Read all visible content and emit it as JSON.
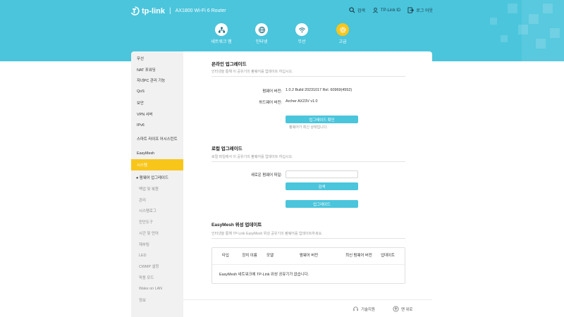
{
  "brand": {
    "name": "tp-link",
    "separator": "|",
    "model": "AX1800 Wi-Fi 6 Router"
  },
  "top_actions": {
    "search": "검색",
    "tplink_id": "TP-Link ID",
    "logout": "로그 아웃"
  },
  "nav": [
    {
      "label": "네트워크 맵"
    },
    {
      "label": "인터넷"
    },
    {
      "label": "무선"
    },
    {
      "label": "고급"
    }
  ],
  "sidebar": {
    "items": [
      {
        "label": "무선"
      },
      {
        "label": "NAT 포워딩"
      },
      {
        "label": "자녀PC 관리 기능"
      },
      {
        "label": "QoS"
      },
      {
        "label": "보안"
      },
      {
        "label": "VPN 서버"
      },
      {
        "label": "IPv6"
      },
      {
        "label": "스마트 라이프 어시스턴트"
      },
      {
        "label": "EasyMesh"
      },
      {
        "label": "시스템"
      }
    ],
    "sub_items": [
      {
        "label": "● 펌웨어 업그레이드"
      },
      {
        "label": "백업 및 복원"
      },
      {
        "label": "관리"
      },
      {
        "label": "시스템로그"
      },
      {
        "label": "진단도구"
      },
      {
        "label": "시간 및 언어"
      },
      {
        "label": "재부팅"
      },
      {
        "label": "LED"
      },
      {
        "label": "CWMP 설정"
      },
      {
        "label": "작동 모드"
      },
      {
        "label": "Wake on LAN"
      },
      {
        "label": "정보"
      }
    ]
  },
  "online_upgrade": {
    "title": "온라인 업그레이드",
    "desc": "인터넷을 통해 이 공유기의 펌웨어를 업데이트 하십시오.",
    "firmware_label": "펌웨어 버전:",
    "firmware_value": "1.0.2 Build 20231017 Rel. 60969(4552)",
    "hardware_label": "하드웨어 버전:",
    "hardware_value": "Archer AX23V v1.0",
    "check_button": "업그레이드 확인",
    "status": "펌웨어가 최신 상태입니다."
  },
  "local_upgrade": {
    "title": "로컬 업그레이드",
    "desc": "로컬 파일에서 이 공유기의 펌웨어를 업데이트 하십시오.",
    "file_label": "새로운 펌웨어 파일:",
    "file_value": "",
    "browse_button": "검색",
    "upgrade_button": "업그레이드"
  },
  "easymesh": {
    "title": "EasyMesh 위성 업데이트",
    "desc": "인터넷을 통해 TP-Link EasyMesh 위성 공유기의 펌웨어를 업데이트하세요.",
    "columns": [
      "타입",
      "장치 이름",
      "모델",
      "펌웨어 버전",
      "최신 펌웨어 버전",
      "업데이트"
    ],
    "empty": "EasyMesh 네트워크에 TP-Link 위성 공유기가 없습니다."
  },
  "footer": {
    "support": "기술지원",
    "back_to_top": "맨 위로"
  },
  "colors": {
    "accent": "#4ac5dc",
    "active": "#f8c61b"
  }
}
